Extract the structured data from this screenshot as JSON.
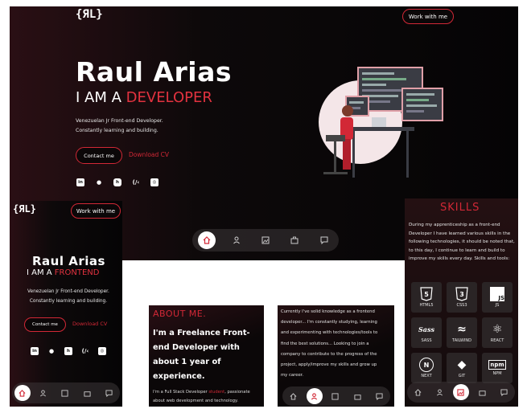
{
  "brand": {
    "logo": "{ЯL}"
  },
  "header": {
    "cta_label": "Work with me"
  },
  "hero": {
    "name": "Raul Arias",
    "subtitle_prefix": "I AM A ",
    "subtitle_role_desktop": "DEVELOPER",
    "subtitle_role_mobile": "FRONTEND",
    "desc_line1": "Venezuelan Jr Front-end Developer.",
    "desc_line2": "Constantly learning and building.",
    "contact_label": "Contact me",
    "cv_label": "Download CV"
  },
  "social": {
    "icons": [
      "linkedin-icon",
      "github-icon",
      "hashnode-icon",
      "freecodecamp-icon",
      "codepen-icon"
    ]
  },
  "nav": {
    "items": [
      "home",
      "about",
      "portfolio",
      "services",
      "contact"
    ]
  },
  "about": {
    "title": "ABOUT ME.",
    "headline_l1": "I'm a Freelance Front-",
    "headline_l2": "end Developer with",
    "headline_l3": "about 1 year of",
    "headline_l4": "experience.",
    "body_l1_prefix": "I'm a Full Stack Developer ",
    "body_l1_highlight": "student",
    "body_l1_suffix": ", passionate",
    "body_l2": "about web development and technology."
  },
  "about_more": {
    "lines": [
      "Currently I've solid knowledge as a frontend",
      "developer... I'm constantly studying, learning",
      "and experimenting with technologies/tools to",
      "find the best solutions... Looking to join a",
      "company to contribute to the progress of the",
      "project, apply/improve my skills and grow up",
      "my career."
    ]
  },
  "skills": {
    "title": "SKILLS",
    "lines": [
      "During my apprenticeship as a front-end",
      "Developer I have learned various skills in the",
      "following technologies, it should be noted that,",
      "to this day, I continue to learn and build to",
      "improve my skills every day. Skills and tools:"
    ],
    "items": [
      {
        "label": "HTML5",
        "glyph": "5"
      },
      {
        "label": "CSS3",
        "glyph": "3"
      },
      {
        "label": "JS",
        "glyph": "JS"
      },
      {
        "label": "SASS",
        "glyph": "Sass"
      },
      {
        "label": "TAILWIND",
        "glyph": "≈"
      },
      {
        "label": "REACT",
        "glyph": "⚛"
      },
      {
        "label": "NEXT",
        "glyph": "N"
      },
      {
        "label": "GIT",
        "glyph": "◆"
      },
      {
        "label": "NPM",
        "glyph": "npm"
      }
    ]
  },
  "colors": {
    "accent": "#d22836",
    "bg": "#0a0708"
  }
}
